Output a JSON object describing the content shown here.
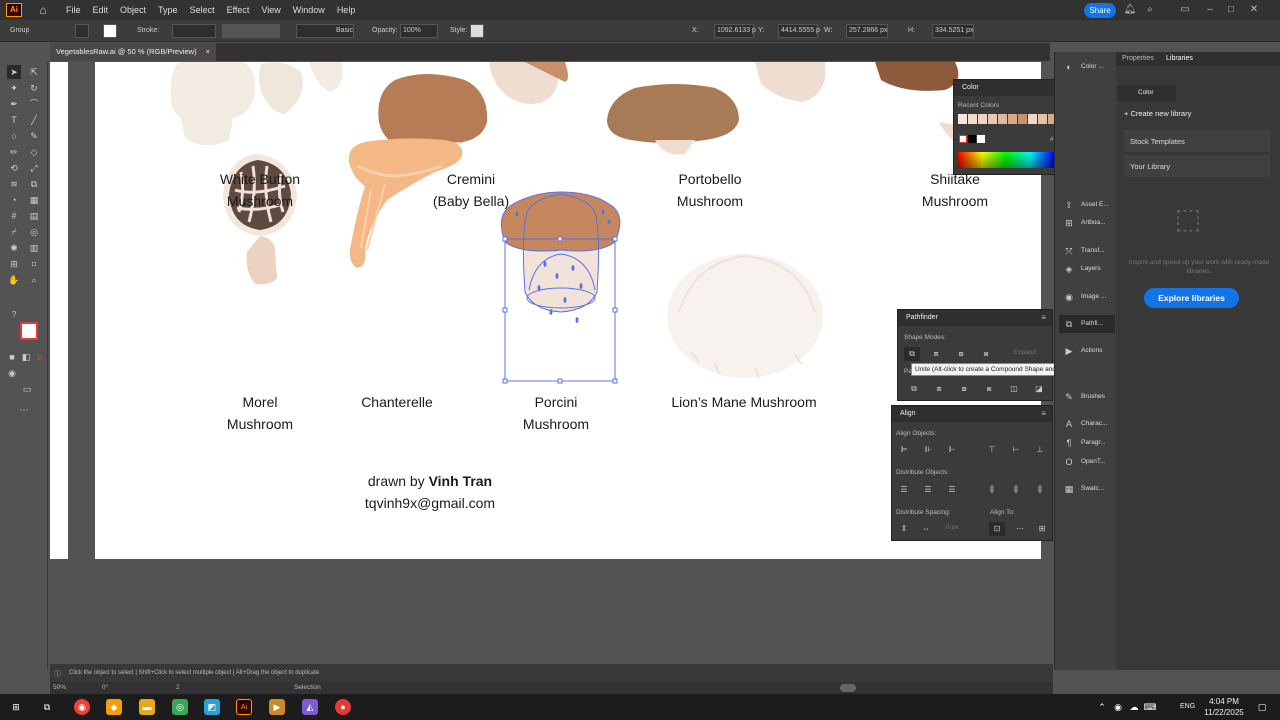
{
  "app": {
    "logo": "Ai",
    "menus": [
      "File",
      "Edit",
      "Object",
      "Type",
      "Select",
      "Effect",
      "View",
      "Window",
      "Help"
    ],
    "share_label": "Share"
  },
  "control_bar": {
    "selection": "Group",
    "stroke_label": "Stroke:",
    "brush": "Basic",
    "opacity_label": "Opacity:",
    "opacity": "100%",
    "style_label": "Style:",
    "x_label": "X:",
    "x": "1092.6133 p",
    "y_label": "Y:",
    "y": "4414.5555 p",
    "w_label": "W:",
    "w": "257.2866 px",
    "h_label": "H:",
    "h": "334.5251 px"
  },
  "document": {
    "tab": "VegetablesRaw.ai @ 50 % (RGB/Preview)",
    "close": "×"
  },
  "artboard": {
    "labels": [
      {
        "line1": "White Button",
        "line2": "Mushroom"
      },
      {
        "line1": "Cremini",
        "line2": "(Baby Bella)"
      },
      {
        "line1": "Portobello",
        "line2": "Mushroom"
      },
      {
        "line1": "Shiitake",
        "line2": "Mushroom"
      },
      {
        "line1": "Morel",
        "line2": "Mushroom"
      },
      {
        "line1": "Chanterelle",
        "line2": ""
      },
      {
        "line1": "Porcini",
        "line2": "Mushroom"
      },
      {
        "line1": "Lion’s Mane Mushroom",
        "line2": ""
      }
    ],
    "credit_prefix": "drawn by ",
    "credit_name": "Vinh Tran",
    "email": "tqvinh9x@gmail.com"
  },
  "color_panel": {
    "title": "Color",
    "recent": "Recent Colors",
    "hex_sign": "#",
    "hex": "f7f3f0",
    "swatches": [
      "#f7e6dc",
      "#f3dccd",
      "#efd4c2",
      "#e9c6b0",
      "#e2b89e",
      "#d9a98a",
      "#c9926f",
      "#f0d8c5",
      "#e6c1a6",
      "#dba985",
      "#efbd96",
      "#f5c9a6",
      "#f0b080",
      "#e8a070"
    ]
  },
  "pathfinder_panel": {
    "title": "Pathfinder",
    "shape_modes": "Shape Modes:",
    "expand": "Expand",
    "pathfinders": "Pa"
  },
  "tooltip": "Unite (Alt-click to create a Compound Shape and add to shape area)",
  "align_panel": {
    "title": "Align",
    "align_objects": "Align Objects:",
    "distribute_objects": "Distribute Objects:",
    "distribute_spacing": "Distribute Spacing:",
    "align_to": "Align To:",
    "spacing": "0 px"
  },
  "dock": [
    "Color ...",
    "Asset E...",
    "Artboa...",
    "Transf...",
    "Layers",
    "Image ...",
    "Pathfi...",
    "Actions",
    "Brushes",
    "Charac...",
    "Paragr...",
    "OpenT...",
    "Swatc..."
  ],
  "libraries": {
    "tabs": [
      "Properties",
      "Libraries"
    ],
    "mini_title": "Color",
    "create": "Create new library",
    "stock": "Stock Templates",
    "your": "Your Library",
    "desc": "Inspire and speed up your work with ready-made libraries.",
    "explore": "Explore libraries"
  },
  "status": {
    "hint": "Click the object to select  |  Shift+Click to select multiple object  |  Alt+Drag the object to duplicate",
    "zoom": "50%",
    "rotation": "0°",
    "artboard": "2",
    "mode": "Selection"
  },
  "taskbar": {
    "lang": "ENG",
    "time": "4:04 PM",
    "date": "11/22/2025"
  }
}
